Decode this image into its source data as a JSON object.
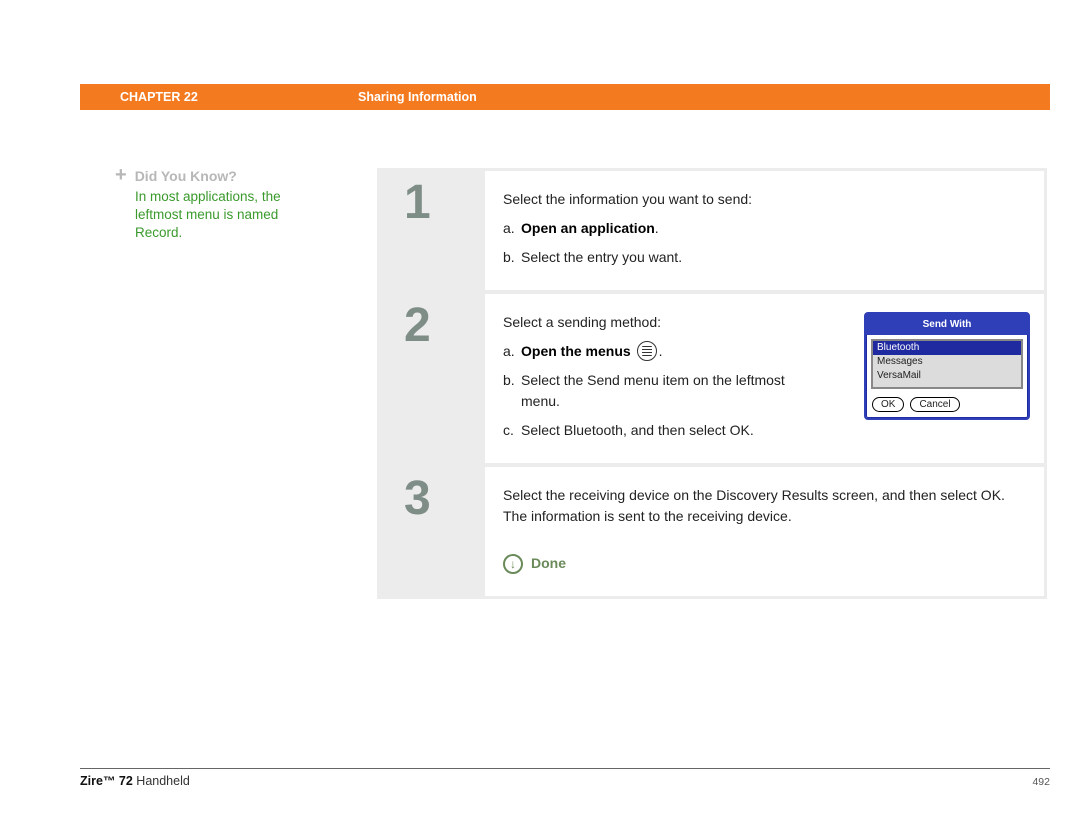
{
  "header": {
    "chapter": "CHAPTER 22",
    "title": "Sharing Information"
  },
  "sidebar": {
    "did_you_know_label": "Did You Know?",
    "did_you_know_body": "In most applications, the leftmost menu is named Record."
  },
  "steps": {
    "s1": {
      "num": "1",
      "intro": "Select the information you want to send:",
      "a_letter": "a.",
      "a_text": "Open an application",
      "a_suffix": ".",
      "b_letter": "b.",
      "b_text": "Select the entry you want."
    },
    "s2": {
      "num": "2",
      "intro": "Select a sending method:",
      "a_letter": "a.",
      "a_text": "Open the menus",
      "a_suffix": ".",
      "b_letter": "b.",
      "b_text": "Select the Send menu item on the leftmost menu.",
      "c_letter": "c.",
      "c_text": "Select Bluetooth, and then select OK."
    },
    "s3": {
      "num": "3",
      "intro": "Select the receiving device on the Discovery Results screen, and then select OK. The information is sent to the receiving device.",
      "done": "Done"
    }
  },
  "sendwith": {
    "title": "Send With",
    "items": {
      "i1": "Bluetooth",
      "i2": "Messages",
      "i3": "VersaMail"
    },
    "ok": "OK",
    "cancel": "Cancel"
  },
  "footer": {
    "product_bold": "Zire™ 72",
    "product_rest": " Handheld",
    "page": "492"
  }
}
